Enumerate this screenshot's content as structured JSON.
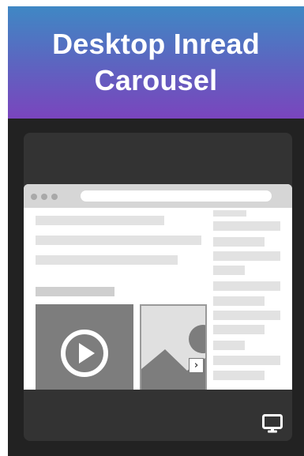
{
  "header": {
    "title": "Desktop Inread Carousel"
  },
  "icons": {
    "play": "play-circle-icon",
    "image": "image-placeholder-icon",
    "next": "chevron-right-icon",
    "device": "desktop-monitor-icon"
  },
  "colors": {
    "gradient_top": "#3f88c4",
    "gradient_bottom": "#7a45bd",
    "panel_bg": "#333333",
    "card_bg": "#222222"
  },
  "carousel": {
    "next_label": "›"
  }
}
